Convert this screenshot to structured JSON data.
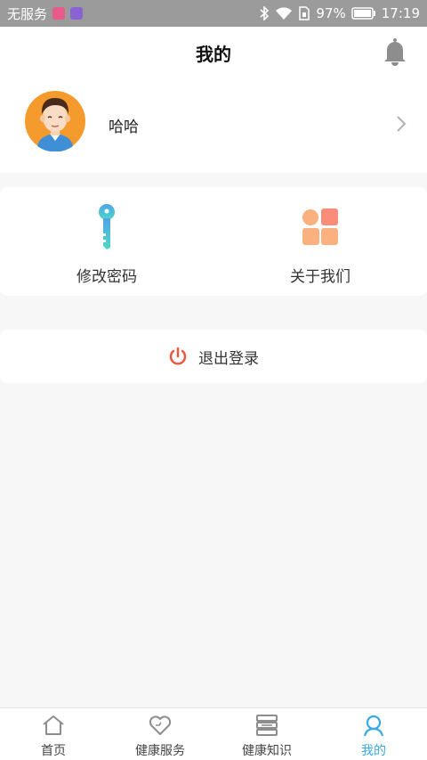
{
  "status_bar": {
    "carrier": "无服务",
    "battery_percent": "97%",
    "time": "17:19"
  },
  "header": {
    "title": "我的"
  },
  "profile": {
    "name": "哈哈"
  },
  "menu": {
    "items": [
      {
        "label": "修改密码",
        "icon": "key-icon"
      },
      {
        "label": "关于我们",
        "icon": "grid-icon"
      }
    ]
  },
  "logout": {
    "label": "退出登录",
    "icon": "power-icon",
    "color": "#e85a3f"
  },
  "tabbar": {
    "items": [
      {
        "label": "首页",
        "icon": "home-icon"
      },
      {
        "label": "健康服务",
        "icon": "heart-icon"
      },
      {
        "label": "健康知识",
        "icon": "knowledge-icon"
      },
      {
        "label": "我的",
        "icon": "profile-icon",
        "active": true
      }
    ],
    "active_color": "#3aa7e6"
  }
}
